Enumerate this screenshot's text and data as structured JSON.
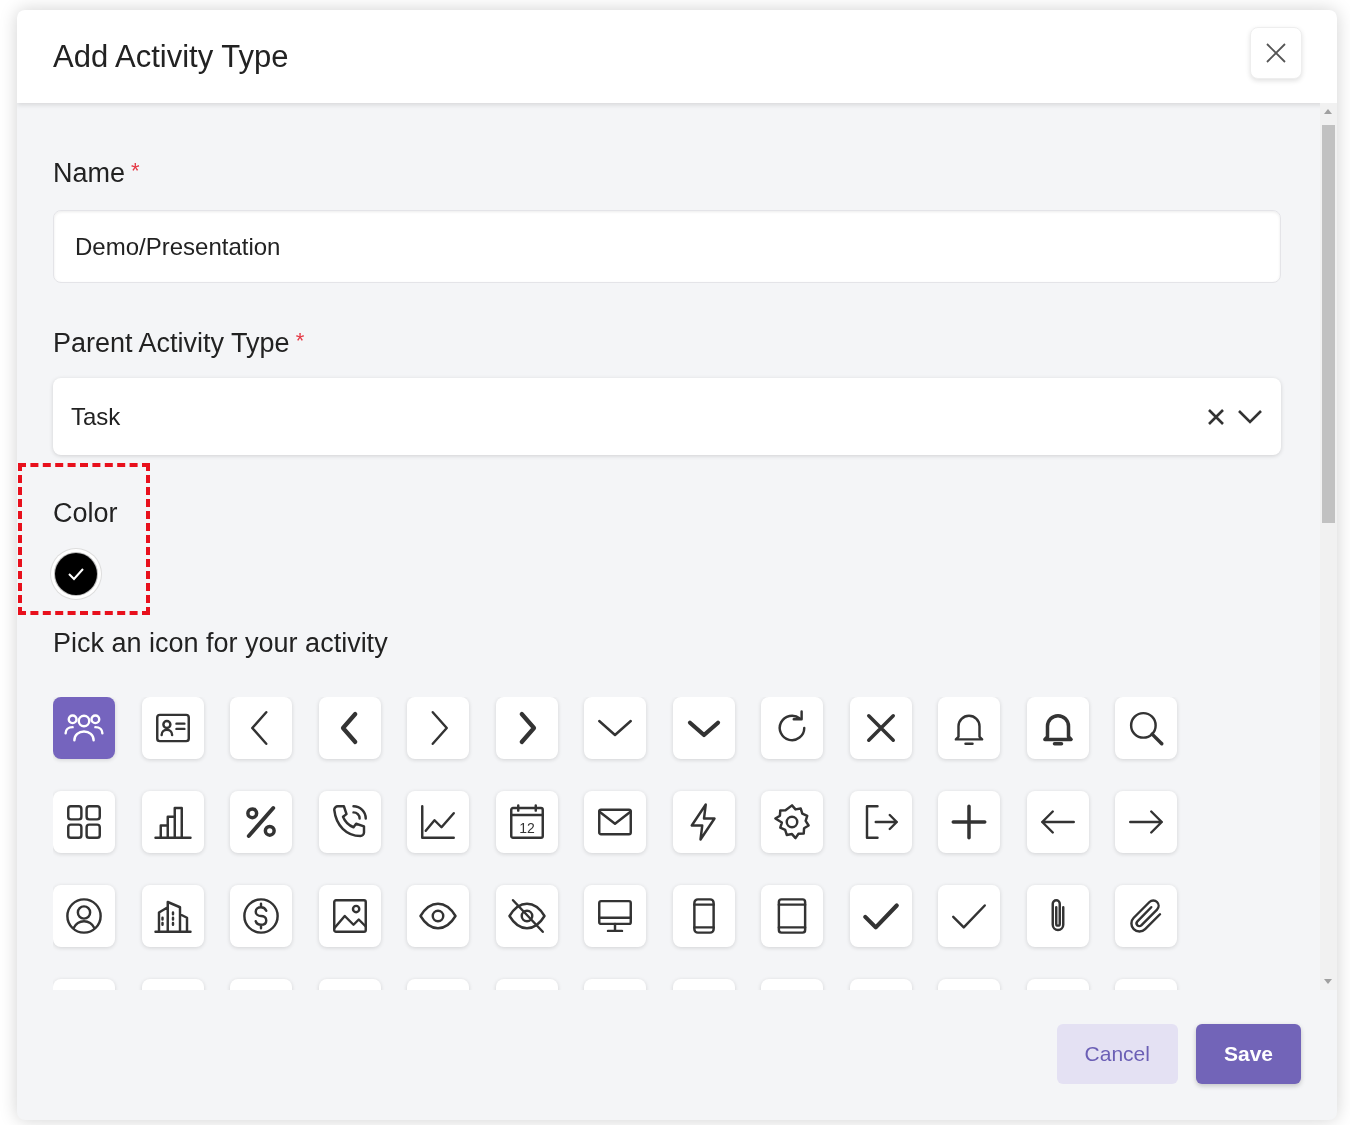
{
  "dialog": {
    "title": "Add Activity Type"
  },
  "name_field": {
    "label": "Name",
    "required_mark": "*",
    "value": "Demo/Presentation"
  },
  "parent_field": {
    "label": "Parent Activity Type",
    "required_mark": "*",
    "value": "Task"
  },
  "color_field": {
    "label": "Color",
    "color": "#000000",
    "selected": true
  },
  "icon_picker": {
    "label": "Pick an icon for your activity",
    "icons": [
      {
        "kind": "users",
        "selected": true
      },
      {
        "kind": "contact-card",
        "selected": false
      },
      {
        "kind": "chevron-left",
        "selected": false
      },
      {
        "kind": "chevron-left-bold",
        "selected": false
      },
      {
        "kind": "chevron-right",
        "selected": false
      },
      {
        "kind": "chevron-right-bold",
        "selected": false
      },
      {
        "kind": "chevron-down",
        "selected": false
      },
      {
        "kind": "chevron-down-bold",
        "selected": false
      },
      {
        "kind": "refresh",
        "selected": false
      },
      {
        "kind": "close",
        "selected": false
      },
      {
        "kind": "bell",
        "selected": false
      },
      {
        "kind": "bell-bold",
        "selected": false
      },
      {
        "kind": "search",
        "selected": false
      },
      {
        "kind": "grid",
        "selected": false
      },
      {
        "kind": "bar-chart",
        "selected": false
      },
      {
        "kind": "percent",
        "selected": false
      },
      {
        "kind": "phone",
        "selected": false
      },
      {
        "kind": "line-chart",
        "selected": false
      },
      {
        "kind": "calendar",
        "label": "12",
        "selected": false
      },
      {
        "kind": "mail",
        "selected": false
      },
      {
        "kind": "bolt",
        "selected": false
      },
      {
        "kind": "gear",
        "selected": false
      },
      {
        "kind": "exit",
        "selected": false
      },
      {
        "kind": "plus",
        "selected": false
      },
      {
        "kind": "arrow-left",
        "selected": false
      },
      {
        "kind": "arrow-right",
        "selected": false
      },
      {
        "kind": "user-circle",
        "selected": false
      },
      {
        "kind": "buildings",
        "selected": false
      },
      {
        "kind": "dollar",
        "selected": false
      },
      {
        "kind": "image",
        "selected": false
      },
      {
        "kind": "eye",
        "selected": false
      },
      {
        "kind": "eye-off",
        "selected": false
      },
      {
        "kind": "monitor",
        "selected": false
      },
      {
        "kind": "mobile",
        "selected": false
      },
      {
        "kind": "tablet",
        "selected": false
      },
      {
        "kind": "check-bold",
        "selected": false
      },
      {
        "kind": "check",
        "selected": false
      },
      {
        "kind": "paperclip",
        "selected": false
      },
      {
        "kind": "paperclip-slanted",
        "selected": false
      },
      {
        "kind": "blank"
      },
      {
        "kind": "blank"
      },
      {
        "kind": "blank"
      },
      {
        "kind": "blank"
      },
      {
        "kind": "blank"
      },
      {
        "kind": "blank"
      },
      {
        "kind": "blank"
      },
      {
        "kind": "blank"
      },
      {
        "kind": "blank"
      },
      {
        "kind": "blank"
      },
      {
        "kind": "blank"
      },
      {
        "kind": "blank"
      },
      {
        "kind": "blank"
      }
    ]
  },
  "buttons": {
    "cancel": "Cancel",
    "save": "Save"
  }
}
